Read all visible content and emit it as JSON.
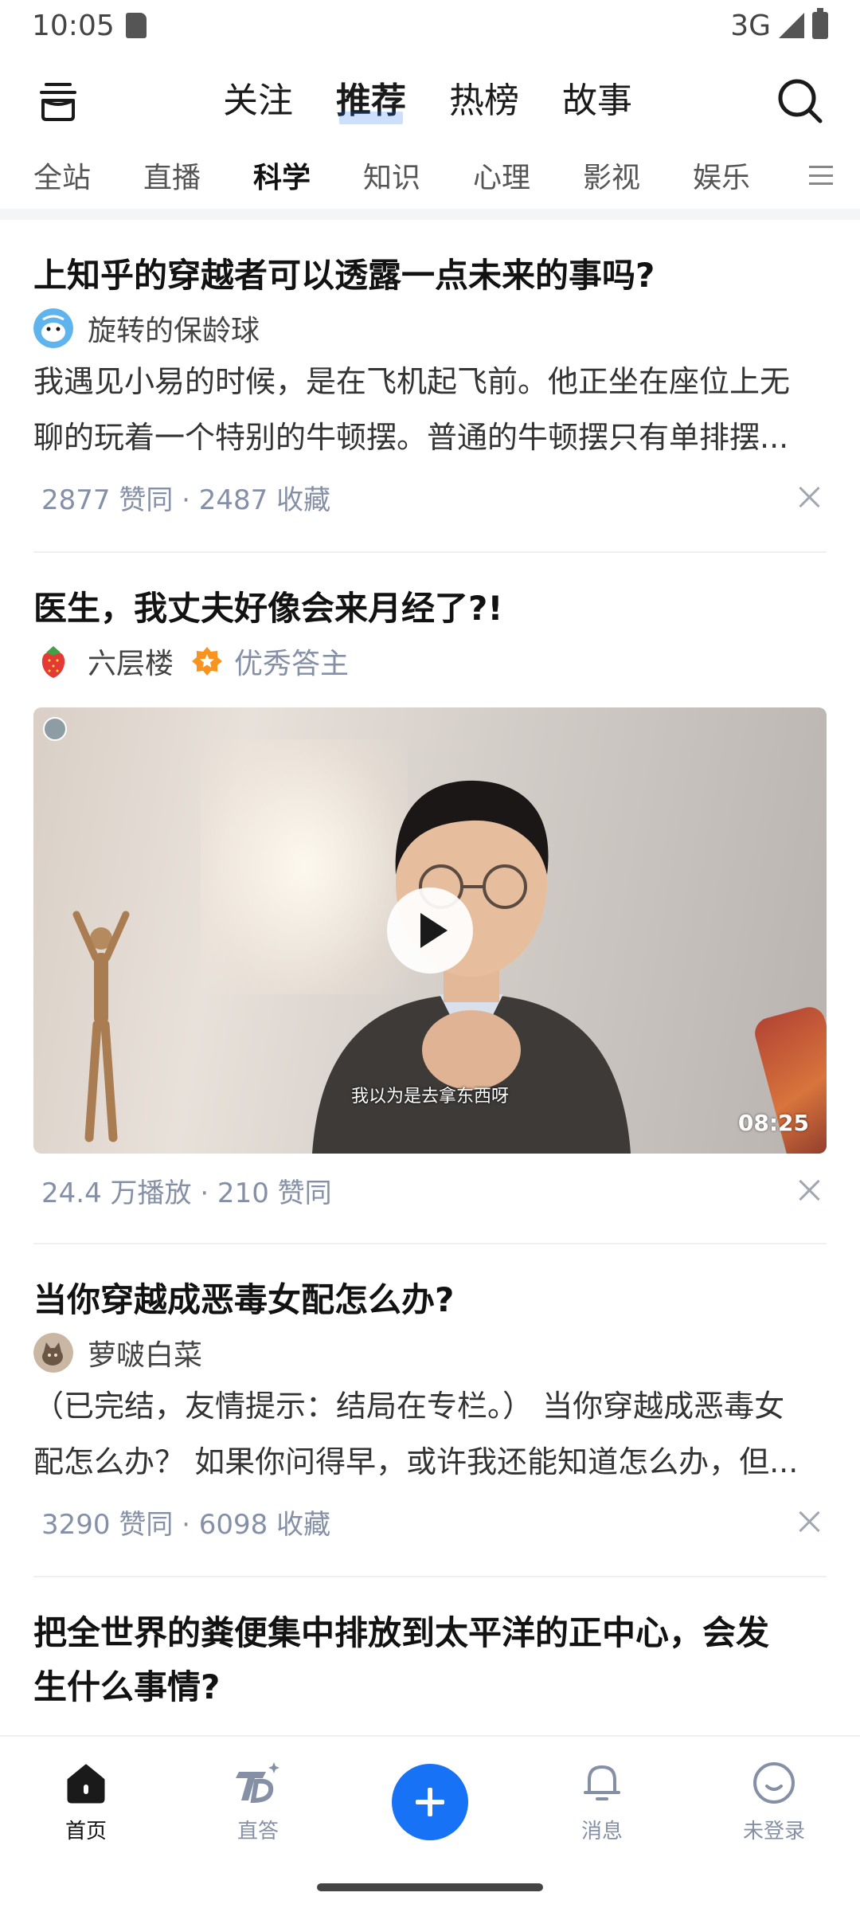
{
  "status_bar": {
    "time": "10:05",
    "network": "3G"
  },
  "top_nav": {
    "tabs": [
      {
        "label": "关注"
      },
      {
        "label": "推荐",
        "active": true
      },
      {
        "label": "热榜"
      },
      {
        "label": "故事"
      }
    ]
  },
  "categories": {
    "items": [
      "全站",
      "直播",
      "科学",
      "知识",
      "心理",
      "影视",
      "娱乐"
    ],
    "active": "科学"
  },
  "feed": [
    {
      "title": "上知乎的穿越者可以透露一点未来的事吗?",
      "author": "旋转的保龄球",
      "excerpt_line1": "我遇见小易的时候，是在飞机起飞前。他正坐在座位上无",
      "excerpt_line2": "聊的玩着一个特别的牛顿摆。普通的牛顿摆只有单排摆...",
      "meta": "2877 赞同 · 2487 收藏"
    },
    {
      "title": "医生，我丈夫好像会来月经了?!",
      "author": "六层楼",
      "author_badge": "优秀答主",
      "video": {
        "subtitle": "我以为是去拿东西呀",
        "duration": "08:25"
      },
      "meta": "24.4 万播放 · 210 赞同"
    },
    {
      "title": "当你穿越成恶毒女配怎么办?",
      "author": "萝啵白菜",
      "excerpt_line1": "（已完结，友情提示：结局在专栏。） 当你穿越成恶毒女",
      "excerpt_line2": "配怎么办？ 如果你问得早，或许我还能知道怎么办，但...",
      "meta": "3290 赞同 · 6098 收藏"
    },
    {
      "title_line1": "把全世界的粪便集中排放到太平洋的正中心，会发",
      "title_line2": "生什么事情?"
    }
  ],
  "bottom_nav": {
    "items": [
      {
        "label": "首页",
        "icon": "home-icon",
        "active": true
      },
      {
        "label": "直答",
        "icon": "zhida-icon"
      },
      {
        "label": "消息",
        "icon": "bell-icon"
      },
      {
        "label": "未登录",
        "icon": "profile-icon"
      }
    ],
    "fab_icon": "plus-icon"
  },
  "colors": {
    "accent": "#1772f6",
    "meta_gray": "#8590a6",
    "title": "#121212"
  }
}
